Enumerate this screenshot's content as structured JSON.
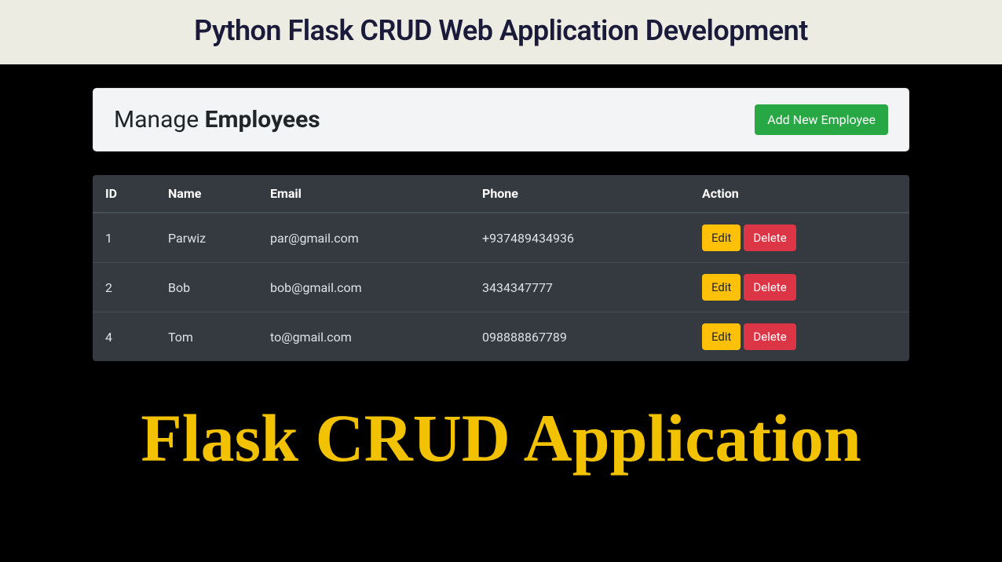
{
  "banner": {
    "title": "Python Flask CRUD Web Application Development"
  },
  "card": {
    "title_light": "Manage ",
    "title_bold": "Employees",
    "add_button": "Add New Employee"
  },
  "table": {
    "headers": {
      "id": "ID",
      "name": "Name",
      "email": "Email",
      "phone": "Phone",
      "action": "Action"
    },
    "rows": [
      {
        "id": "1",
        "name": "Parwiz",
        "email": "par@gmail.com",
        "phone": "+937489434936"
      },
      {
        "id": "2",
        "name": "Bob",
        "email": "bob@gmail.com",
        "phone": "3434347777"
      },
      {
        "id": "4",
        "name": "Tom",
        "email": "to@gmail.com",
        "phone": "098888867789"
      }
    ],
    "actions": {
      "edit": "Edit",
      "delete": "Delete"
    }
  },
  "footer": {
    "title": "Flask CRUD Application"
  }
}
